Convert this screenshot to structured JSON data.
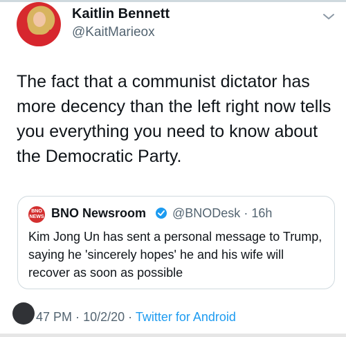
{
  "author": {
    "name": "Kaitlin Bennett",
    "handle": "@KaitMarieox"
  },
  "tweet": {
    "text": "The fact that a communist dictator has more decency than the left right now tells you everything you need to know about the Democratic Party."
  },
  "quoted": {
    "logo_text": "BNO NEWS",
    "name": "BNO Newsroom",
    "handle": "@BNODesk",
    "separator": "·",
    "time": "16h",
    "text": "Kim Jong Un has sent a personal message to Trump, saying he 'sincerely hopes' he and his wife will recover as soon as possible"
  },
  "footer": {
    "time": "47 PM",
    "date": "10/2/20",
    "separator": "·",
    "source": "Twitter for Android"
  },
  "colors": {
    "accent": "#1d9bf0",
    "muted": "#536471",
    "text": "#0f1419"
  },
  "icons": {
    "chevron": "chevron-down-icon",
    "verified": "verified-badge-icon",
    "accessibility": "accessibility-icon"
  }
}
